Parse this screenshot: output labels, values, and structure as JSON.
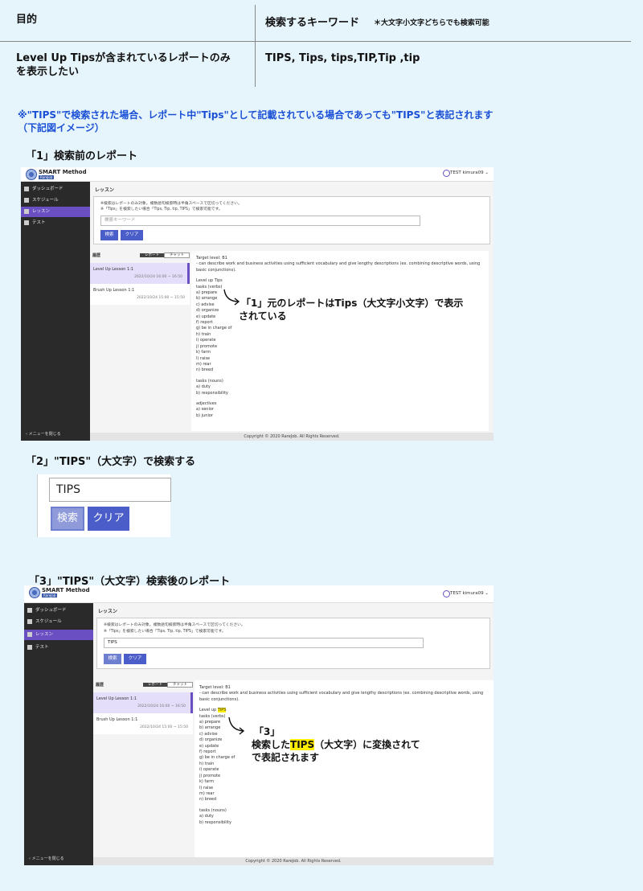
{
  "table": {
    "col1_header": "目的",
    "col2_header": "検索するキーワード",
    "col2_header_note": "＊大文字小文字どちらでも検索可能",
    "row1_purpose": "Level Up Tipsが含まれているレポートのみを表示したい",
    "row1_keywords": "TIPS, Tips, tips,TIP,Tip ,tip"
  },
  "note": {
    "line1": "※\"TIPS\"で検索された場合、レポート中\"Tips\"として記載されている場合であっても\"TIPS\"と表記されます",
    "line2": "（下記図イメージ）"
  },
  "sections": {
    "s1": "「1」検索前のレポート",
    "s2": "「2」\"TIPS\"（大文字）で検索する",
    "s3": "「3」\"TIPS\"（大文字）検索後のレポート"
  },
  "app": {
    "brand": "SMART Method",
    "brand_sub": "RareJob",
    "user": "TEST kimura09 ⌄",
    "nav": [
      "ダッシュボード",
      "スケジュール",
      "レッスン",
      "テスト"
    ],
    "close_menu": "メニューを閉じる",
    "page_title": "レッスン",
    "help1": "※検索はレポートのみ対象。複数語句検索時は半角スペースで区切ってください。",
    "help2": "※「Tips」を検索したい場合「Tips, Tip, tip, TIPS」で検索可能です。",
    "search_placeholder": "検索キーワード",
    "search_button": "検索",
    "clear_button": "クリア",
    "history_label": "履歴",
    "tab_report": "レポート",
    "tab_chat": "チャット",
    "history": [
      {
        "title": "Level Up Lesson 1:1",
        "date": "2022/10/24 16:00 ~ 16:50"
      },
      {
        "title": "Brush Up Lesson 1:1",
        "date": "2022/10/24 15:00 ~ 15:50"
      }
    ],
    "copyright": "Copyright © 2020 RareJob. All Rights Reserved."
  },
  "report": {
    "target": "Target level: B1",
    "desc": "- can describe work and business activities using sufficient vocabulary and give lengthy descriptions (ex. combining descriptive words, using basic conjunctions).",
    "tips_before": "Level up Tips",
    "tips_after_prefix": "Level up ",
    "tips_after_word": "TIPS",
    "verbs_header": "tasks (verbs)",
    "verbs": [
      "a) prepare",
      "b) arrange",
      "c) advise",
      "d) organize",
      "e) update",
      "f) report",
      "g) be in charge of",
      "h) train",
      "i) operate",
      "j) promote",
      "k) farm",
      "l) raise",
      "m) rear",
      "n) breed"
    ],
    "nouns_header": "tasks (nouns)",
    "nouns": [
      "a) duty",
      "b) responsibility"
    ],
    "adj_header": "adjectives",
    "adjs": [
      "a) senior",
      "b) junior"
    ]
  },
  "zoom": {
    "value": "TIPS",
    "search_button": "検索",
    "clear_button": "クリア"
  },
  "after_search_value": "TIPS",
  "annotations": {
    "a1_line1": "「1」元のレポートはTips（大文字小文字）で表示",
    "a1_line2": "されている",
    "a3_line1": "「3」",
    "a3_line2_pre": "検索した",
    "a3_line2_hl": "TIPS",
    "a3_line2_post": "（大文字）に変換されて",
    "a3_line3": "で表記されます"
  }
}
